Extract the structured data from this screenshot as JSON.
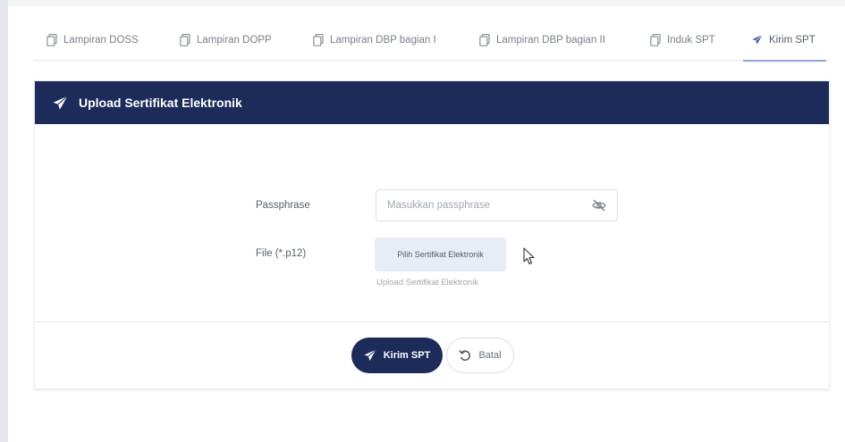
{
  "tabs": [
    {
      "label": "Lampiran DOSS",
      "icon": "copy-icon"
    },
    {
      "label": "Lampiran DOPP",
      "icon": "copy-icon"
    },
    {
      "label": "Lampiran DBP bagian I",
      "icon": "copy-icon"
    },
    {
      "label": "Lampiran DBP bagian II",
      "icon": "copy-icon"
    },
    {
      "label": "Induk SPT",
      "icon": "copy-icon"
    },
    {
      "label": "Kirim SPT",
      "icon": "paper-plane-icon",
      "active": true
    }
  ],
  "panel": {
    "title": "Upload Sertifikat Elektronik",
    "header_color": "#1c2b5a",
    "passphrase": {
      "label": "Passphrase",
      "placeholder": "Masukkan passphrase",
      "value": ""
    },
    "file": {
      "label": "File (*.p12)",
      "button_label": "Pilih Sertifikat Elektronik",
      "hint": "Upload Sertifikat Elektronik"
    }
  },
  "actions": {
    "submit_label": "Kirim SPT",
    "cancel_label": "Batal"
  },
  "colors": {
    "primary": "#1c2b5a",
    "active_tab_underline": "#8fa7d6",
    "file_button_bg": "#e8ecf6"
  }
}
